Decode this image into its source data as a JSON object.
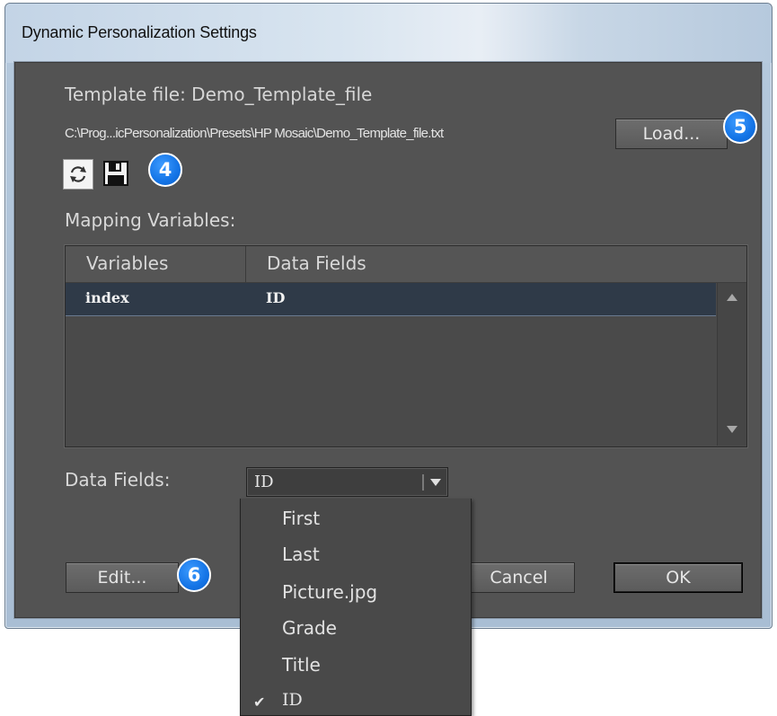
{
  "window": {
    "title": "Dynamic Personalization Settings"
  },
  "template": {
    "label": "Template file: Demo_Template_file",
    "path": "C:\\Prog...icPersonalization\\Presets\\HP Mosaic\\Demo_Template_file.txt",
    "load_label": "Load..."
  },
  "toolbar": {
    "icons": [
      "sync-icon",
      "save-icon"
    ]
  },
  "mapping": {
    "label": "Mapping Variables:",
    "columns": [
      "Variables",
      "Data Fields"
    ],
    "rows": [
      {
        "variable": "index",
        "field": "ID"
      }
    ]
  },
  "datafields": {
    "label": "Data Fields:",
    "selected": "ID",
    "options": [
      "First",
      "Last",
      "Picture.jpg",
      "Grade",
      "Title",
      "ID"
    ],
    "checkmark": "✔"
  },
  "buttons": {
    "edit": "Edit...",
    "cancel": "Cancel",
    "ok": "OK"
  },
  "callouts": {
    "c4": "4",
    "c5": "5",
    "c6": "6"
  },
  "colors": {
    "callout": "#1474e6",
    "dialog_bg": "#535353",
    "selected_row": "#2f3a48"
  }
}
